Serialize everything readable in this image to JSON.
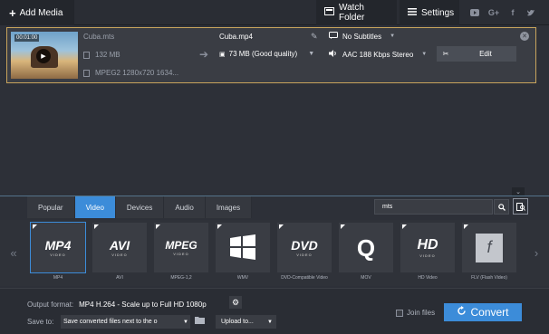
{
  "toolbar": {
    "add_media_label": "Add Media",
    "watch_folder_label": "Watch Folder",
    "settings_label": "Settings",
    "social": [
      "youtube-icon",
      "googleplus-icon",
      "facebook-icon",
      "twitter-icon"
    ]
  },
  "file": {
    "thumb_time": "00:01:00",
    "source_name": "Cuba.mts",
    "source_size": "132 MB",
    "source_codec": "MPEG2 1280x720 1634...",
    "output_name": "Cuba.mp4",
    "output_size": "73 MB (Good quality)",
    "subtitles": "No Subtitles",
    "audio": "AAC 188 Kbps Stereo",
    "edit_label": "Edit"
  },
  "formats": {
    "tabs": [
      {
        "label": "Popular",
        "active": false
      },
      {
        "label": "Video",
        "active": true
      },
      {
        "label": "Devices",
        "active": false
      },
      {
        "label": "Audio",
        "active": false
      },
      {
        "label": "Images",
        "active": false
      }
    ],
    "search_value": "mts",
    "presets": [
      {
        "logo": "MP4",
        "sub": "VIDEO",
        "caption": "MP4"
      },
      {
        "logo": "AVI",
        "sub": "VIDEO",
        "caption": "AVI"
      },
      {
        "logo": "MPEG",
        "sub": "VIDEO",
        "caption": "MPEG-1,2"
      },
      {
        "logo": "",
        "sub": "",
        "caption": "WMV"
      },
      {
        "logo": "DVD",
        "sub": "VIDEO",
        "caption": "DVD-Compatible Video"
      },
      {
        "logo": "Q",
        "sub": "",
        "caption": "MOV"
      },
      {
        "logo": "HD",
        "sub": "VIDEO",
        "caption": "HD Video"
      },
      {
        "logo": "f",
        "sub": "",
        "caption": "FLV (Flash Video)"
      }
    ]
  },
  "bottom": {
    "output_format_label": "Output format:",
    "output_format_value": "MP4 H.264 - Scale up to Full HD 1080p",
    "save_to_label": "Save to:",
    "save_to_value": "Save converted files next to the o",
    "upload_label": "Upload to...",
    "join_files_label": "Join files",
    "convert_label": "Convert"
  },
  "colors": {
    "accent": "#3c8cd9",
    "selection_border": "#c8a45c",
    "background": "#2d3038"
  }
}
